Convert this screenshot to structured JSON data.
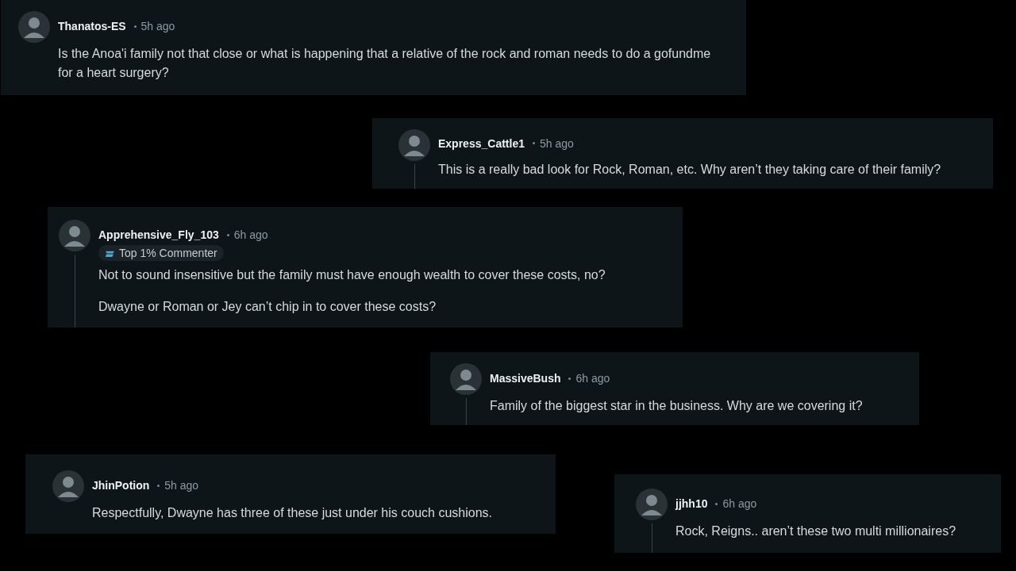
{
  "comments": [
    {
      "username": "Thanatos-ES",
      "time": "5h ago",
      "thread_line": false,
      "paragraphs": [
        "Is the Anoa'i family not that close or what is happening that a relative of the rock and roman needs to do a gofundme for a heart surgery?"
      ]
    },
    {
      "username": "Express_Cattle1",
      "time": "5h ago",
      "thread_line": true,
      "paragraphs": [
        "This is a really bad look for Rock, Roman, etc.  Why aren’t they taking care of their family?"
      ]
    },
    {
      "username": "Apprehensive_Fly_103",
      "time": "6h ago",
      "thread_line": true,
      "badge": "Top 1% Commenter",
      "paragraphs": [
        "Not to sound insensitive but the family must have enough wealth to cover these costs, no?",
        "Dwayne or Roman or Jey can’t chip in to cover these costs?"
      ]
    },
    {
      "username": "MassiveBush",
      "time": "6h ago",
      "thread_line": true,
      "paragraphs": [
        "Family of the biggest star in the business. Why are we covering it?"
      ]
    },
    {
      "username": "JhinPotion",
      "time": "5h ago",
      "thread_line": false,
      "paragraphs": [
        "Respectfully, Dwayne has three of these just under his couch cushions."
      ]
    },
    {
      "username": "jjhh10",
      "time": "6h ago",
      "thread_line": true,
      "paragraphs": [
        "Rock, Reigns.. aren’t these two multi millionaires?"
      ]
    }
  ]
}
